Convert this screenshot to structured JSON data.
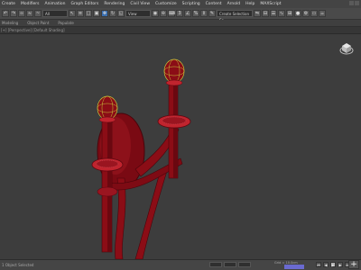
{
  "menu": {
    "items": [
      "Create",
      "Modifiers",
      "Animation",
      "Graph Editors",
      "Rendering",
      "Civil View",
      "Customize",
      "Scripting",
      "Content",
      "Arnold",
      "Help",
      "MAXScript"
    ]
  },
  "toolbar": {
    "selection_filter": "All",
    "view_selector": "View",
    "selection_set": "Create Selection Se"
  },
  "ribbon": {
    "tabs": [
      "Modeling",
      "Object Paint",
      "Populate"
    ]
  },
  "viewport": {
    "label": "[+] [Perspective] [Default Shading]"
  },
  "status": {
    "left_text": "1 Object Selected",
    "right_line1": "Grid = 10.0cm",
    "right_line2": "Add Time Tag",
    "auto_key_color": "#6a6ad0"
  },
  "colors": {
    "model": "#8b0d16",
    "model_dark": "#5e0710",
    "model_light": "#c0242e",
    "selection": "#d9d94a"
  }
}
